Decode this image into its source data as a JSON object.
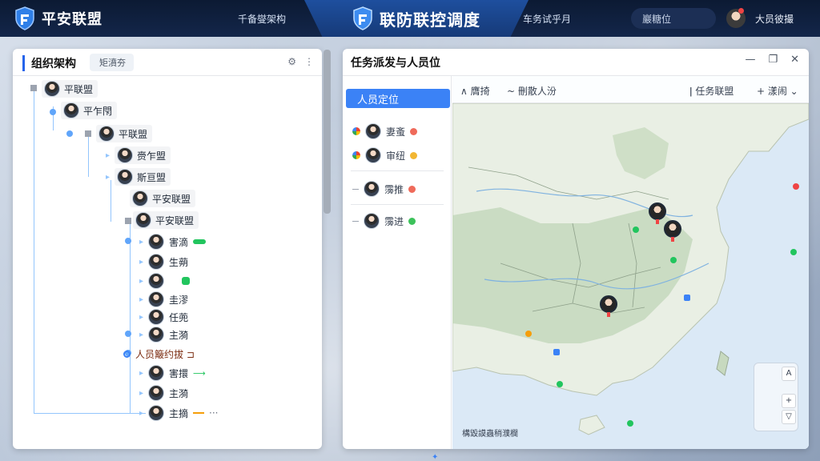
{
  "header": {
    "brand": "平安联盟",
    "nav_left": "千备燮架构",
    "title": "联防联控调度",
    "nav_right": "车务试乎月",
    "search_placeholder": "巖糖位",
    "user": "大员彼撮"
  },
  "left_panel": {
    "title": "组织架构",
    "tag": "矩濆夯",
    "icons": [
      "settings-icon",
      "more-icon"
    ],
    "nodes": [
      {
        "label": "平联盟"
      },
      {
        "label": "平乍閇"
      },
      {
        "label": "平联盟"
      },
      {
        "label": "赍乍盟"
      },
      {
        "label": "斯亘盟"
      },
      {
        "label": "平安联盟"
      },
      {
        "label": "平安联盟"
      },
      {
        "label": "害滴",
        "status": "green"
      },
      {
        "label": "生蒴"
      },
      {
        "label": "",
        "status": "green-dot"
      },
      {
        "label": "圭漻"
      },
      {
        "label": "任蔸"
      },
      {
        "label": "主漪"
      },
      {
        "label": "人员簸约拔 ⊐"
      },
      {
        "label": "害擐",
        "status": "green-arrow"
      },
      {
        "label": "主漪"
      },
      {
        "label": "主摘",
        "status": "orange"
      }
    ]
  },
  "right_panel": {
    "title": "任务派发与人员位",
    "tab": "人员定位",
    "persons": [
      {
        "name": "妻蚉",
        "status_color": "#ef6a5a"
      },
      {
        "name": "审纽",
        "status_color": "#f2b632"
      },
      {
        "name": "霶推",
        "status_color": "#ef6a5a"
      },
      {
        "name": "霶进",
        "status_color": "#3cc25a"
      }
    ],
    "map_toolbar": {
      "left1": "∧ 膺掎",
      "left2": "~ 刪散人汾",
      "right1": "ǀ 任务联盟",
      "right2": "+ 漾闹 ⌄"
    },
    "map_caption": "構毀謨蟲稍濮欄",
    "zoom": [
      "A",
      "+",
      "▽"
    ]
  },
  "colors": {
    "header_bg": "#0c1a33",
    "accent": "#3b82f6",
    "red": "#ef4444",
    "green": "#22c55e",
    "orange": "#f59e0b"
  }
}
